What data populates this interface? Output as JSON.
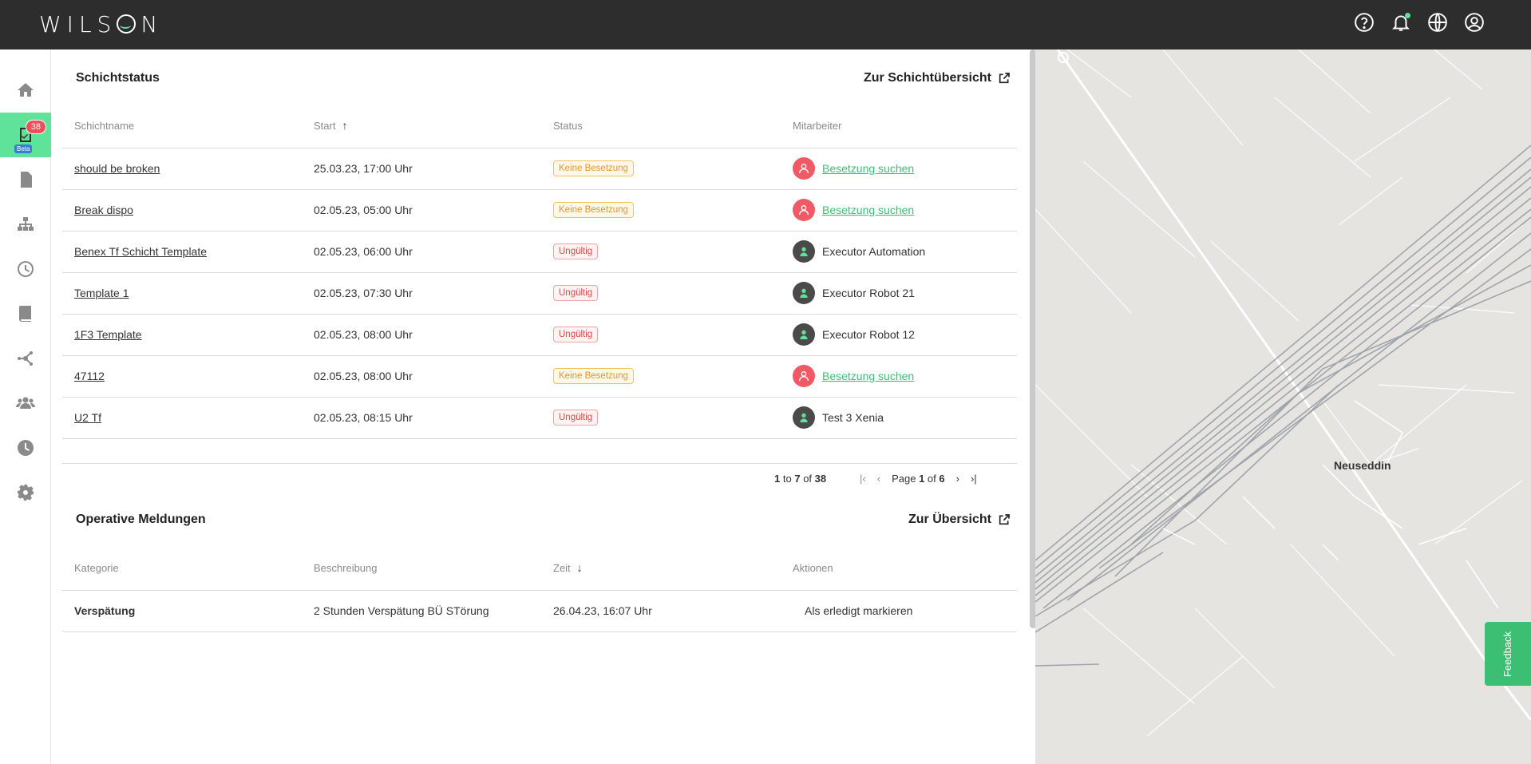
{
  "app": {
    "logo": "WILSON"
  },
  "header": {
    "icons": [
      "help-icon",
      "bell-icon",
      "globe-icon",
      "account-icon"
    ]
  },
  "sidebar": {
    "items": [
      "home-icon",
      "shift-icon",
      "report-icon",
      "network-icon",
      "clock-icon",
      "book-icon",
      "graph-icon",
      "users-icon",
      "history-icon",
      "gear-icon"
    ],
    "active_badge": "38",
    "beta_label": "Beta"
  },
  "shift_status": {
    "title": "Schichtstatus",
    "link": "Zur Schichtübersicht",
    "columns": [
      "Schichtname",
      "Start",
      "Status",
      "Mitarbeiter"
    ],
    "rows": [
      {
        "name": "should be broken",
        "start": "25.03.23, 17:00 Uhr",
        "status": "Keine Besetzung",
        "status_type": "warn",
        "employee": "Besetzung suchen",
        "employee_type": "search"
      },
      {
        "name": "Break dispo",
        "start": "02.05.23, 05:00 Uhr",
        "status": "Keine Besetzung",
        "status_type": "warn",
        "employee": "Besetzung suchen",
        "employee_type": "search"
      },
      {
        "name": "Benex Tf Schicht Template",
        "start": "02.05.23, 06:00 Uhr",
        "status": "Ungültig",
        "status_type": "err",
        "employee": "Executor Automation",
        "employee_type": "person"
      },
      {
        "name": "Template 1",
        "start": "02.05.23, 07:30 Uhr",
        "status": "Ungültig",
        "status_type": "err",
        "employee": "Executor Robot 21",
        "employee_type": "person"
      },
      {
        "name": "1F3 Template",
        "start": "02.05.23, 08:00 Uhr",
        "status": "Ungültig",
        "status_type": "err",
        "employee": "Executor Robot 12",
        "employee_type": "person"
      },
      {
        "name": "47112",
        "start": "02.05.23, 08:00 Uhr",
        "status": "Keine Besetzung",
        "status_type": "warn",
        "employee": "Besetzung suchen",
        "employee_type": "search"
      },
      {
        "name": "U2 Tf",
        "start": "02.05.23, 08:15 Uhr",
        "status": "Ungültig",
        "status_type": "err",
        "employee": "Test 3 Xenia",
        "employee_type": "person"
      }
    ],
    "pager": {
      "from": "1",
      "to_word": "to",
      "to": "7",
      "of_word": "of",
      "total": "38",
      "page_word": "Page",
      "page": "1",
      "page_of": "of",
      "pages": "6"
    }
  },
  "messages": {
    "title": "Operative Meldungen",
    "link": "Zur Übersicht",
    "columns": [
      "Kategorie",
      "Beschreibung",
      "Zeit",
      "Aktionen"
    ],
    "rows": [
      {
        "category": "Verspätung",
        "description": "2 Stunden Verspätung BÜ STörung",
        "time": "26.04.23, 16:07 Uhr",
        "action": "Als erledigt markieren"
      }
    ]
  },
  "map": {
    "label": "Neuseddin"
  },
  "feedback": {
    "label": "Feedback"
  },
  "colors": {
    "accent": "#5fe39b",
    "header_bg": "#2d2d2d",
    "warn": "#e8962a",
    "error": "#e04848",
    "link_green": "#3dbf73"
  }
}
